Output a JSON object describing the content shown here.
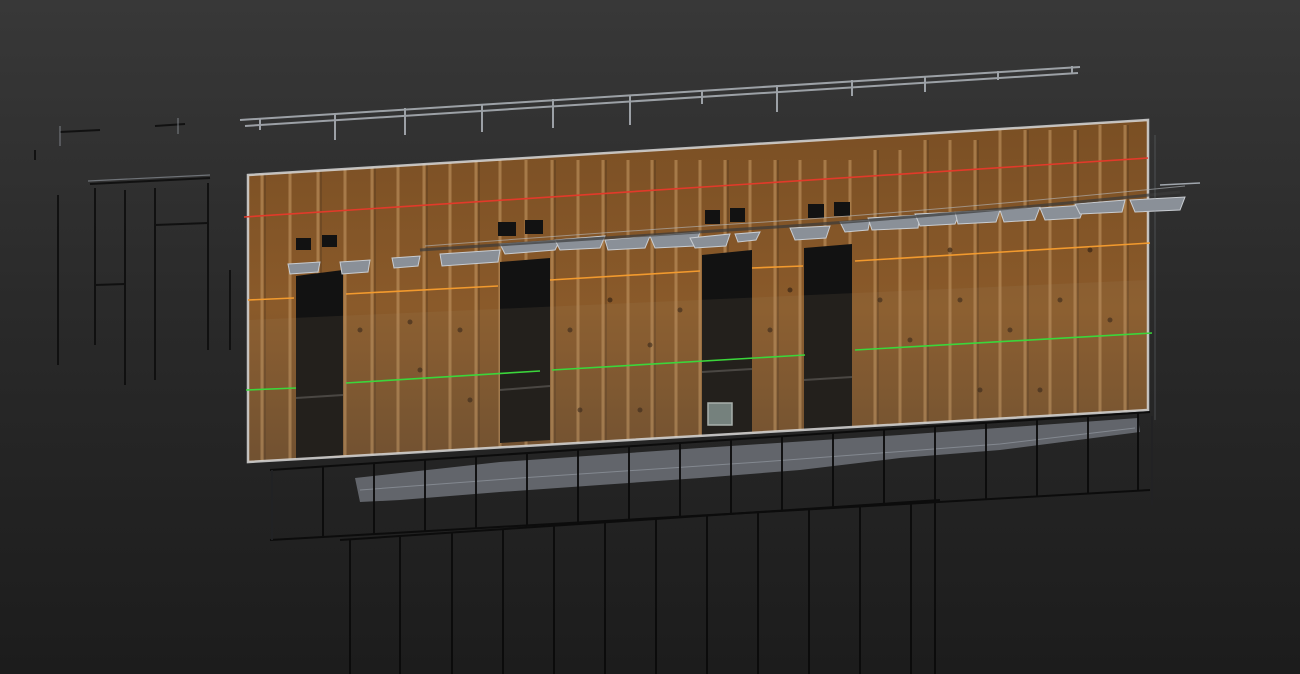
{
  "viewport": {
    "mode": "3d-point-cloud",
    "background": [
      "#383838",
      "#1c1c1c"
    ]
  },
  "scan": {
    "subject": "wall-framing-elevation",
    "wall_tint": "#8a5a2a",
    "stud_color": "#b08a5e",
    "outline_color": "#d8d8d8",
    "ceiling_point_color": "#9aa0a8",
    "floor_point_color": "#7b7f86"
  },
  "markers": {
    "lines": [
      {
        "id": "red-level-line",
        "color": "#e23a2a"
      },
      {
        "id": "orange-level-line",
        "color": "#f29a2e"
      },
      {
        "id": "green-level-line",
        "color": "#3bd63b"
      }
    ]
  }
}
